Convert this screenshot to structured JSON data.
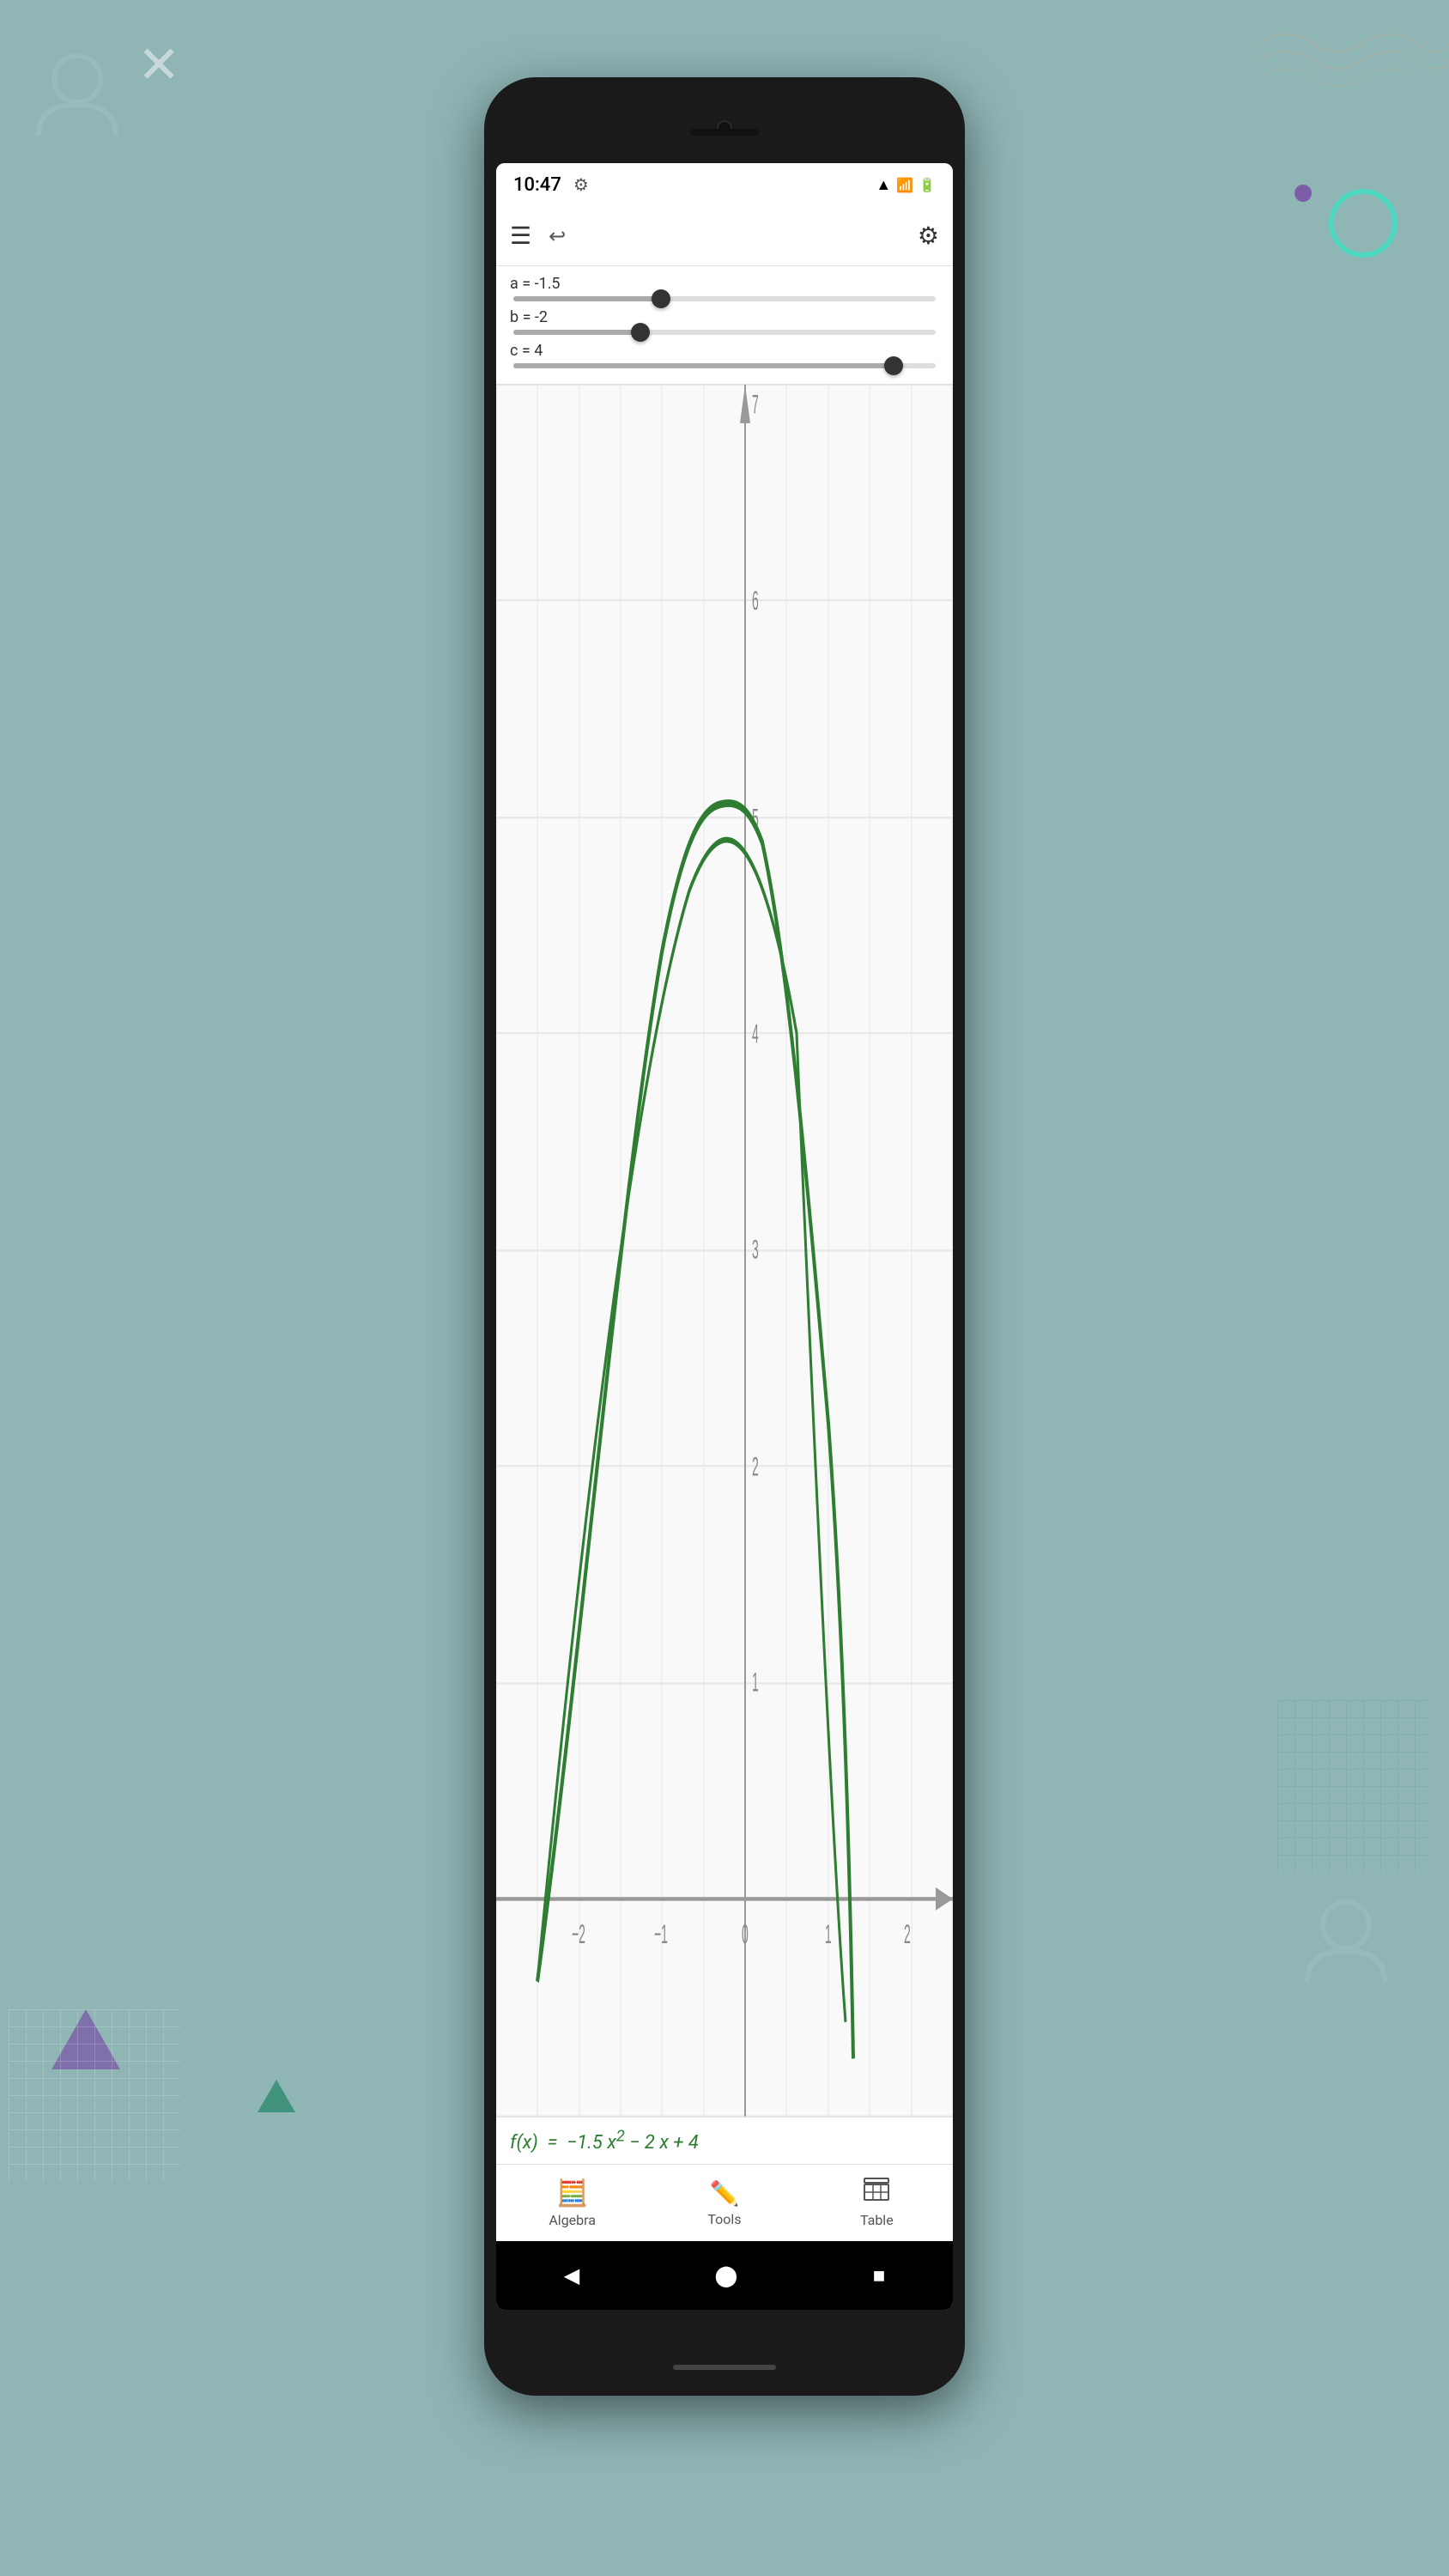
{
  "background": {
    "color": "#8fb5b5"
  },
  "statusBar": {
    "time": "10:47",
    "settingsVisible": true
  },
  "toolbar": {
    "hamburgerLabel": "menu",
    "undoLabel": "undo",
    "gearLabel": "settings"
  },
  "sliders": [
    {
      "id": "a",
      "label": "a = -1.5",
      "value": -1.5,
      "min": -5,
      "max": 5,
      "thumbPercent": 35
    },
    {
      "id": "b",
      "label": "b = -2",
      "value": -2,
      "min": -5,
      "max": 5,
      "thumbPercent": 30
    },
    {
      "id": "c",
      "label": "c = 4",
      "value": 4,
      "min": -5,
      "max": 5,
      "thumbPercent": 90
    }
  ],
  "graph": {
    "xMin": -3,
    "xMax": 2.5,
    "yMin": -1,
    "yMax": 7,
    "xLabels": [
      "-2",
      "-1",
      "0",
      "1",
      "2"
    ],
    "yLabels": [
      "1",
      "2",
      "3",
      "4",
      "5",
      "6",
      "7"
    ]
  },
  "formula": {
    "text": "f(x) = −1.5 x² − 2 x + 4"
  },
  "bottomNav": {
    "items": [
      {
        "id": "algebra",
        "label": "Algebra",
        "icon": "calculator"
      },
      {
        "id": "tools",
        "label": "Tools",
        "icon": "tools"
      },
      {
        "id": "table",
        "label": "Table",
        "icon": "table"
      }
    ]
  },
  "androidNav": {
    "back": "◀",
    "home": "⬤",
    "recent": "■"
  }
}
